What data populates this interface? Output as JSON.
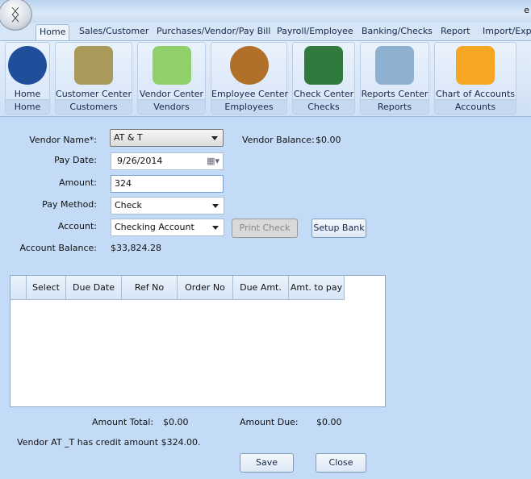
{
  "title_bar": {
    "right_text": "e"
  },
  "tabs": [
    "Home",
    "Sales/Customer",
    "Purchases/Vendor/Pay Bill",
    "Payroll/Employee",
    "Banking/Checks",
    "Report",
    "Import/Expo"
  ],
  "ribbon": [
    {
      "label": "Home",
      "group": "Home",
      "icon": "home-icon",
      "color": "#1f4f9a"
    },
    {
      "label": "Customer Center",
      "group": "Customers",
      "icon": "customer-folder-icon",
      "color": "#a99a5a"
    },
    {
      "label": "Vendor Center",
      "group": "Vendors",
      "icon": "vendor-book-icon",
      "color": "#8fd06a"
    },
    {
      "label": "Employee Center",
      "group": "Employees",
      "icon": "employee-group-icon",
      "color": "#b0702a"
    },
    {
      "label": "Check Center",
      "group": "Checks",
      "icon": "checkbook-icon",
      "color": "#2f7a3c"
    },
    {
      "label": "Reports Center",
      "group": "Reports",
      "icon": "reports-binder-icon",
      "color": "#8fb1d1"
    },
    {
      "label": "Chart of Accounts",
      "group": "Accounts",
      "icon": "accounts-folder-icon",
      "color": "#f5a623"
    }
  ],
  "form": {
    "vendor_name_label": "Vendor Name*:",
    "vendor_name": "AT & T",
    "vendor_balance_label": "Vendor Balance:",
    "vendor_balance": "$0.00",
    "pay_date_label": "Pay Date:",
    "pay_date": "9/26/2014",
    "amount_label": "Amount:",
    "amount": "324",
    "pay_method_label": "Pay Method:",
    "pay_method": "Check",
    "account_label": "Account:",
    "account": "Checking Account",
    "print_check": "Print Check",
    "setup_bank": "Setup Bank",
    "account_balance_label": "Account Balance:",
    "account_balance": "$33,824.28"
  },
  "grid": {
    "columns": [
      "Select",
      "Due Date",
      "Ref No",
      "Order No",
      "Due Amt.",
      "Amt. to pay"
    ]
  },
  "totals": {
    "amount_total_label": "Amount Total:",
    "amount_total": "$0.00",
    "amount_due_label": "Amount Due:",
    "amount_due": "$0.00"
  },
  "message": "Vendor AT _T has credit amount $324.00.",
  "buttons": {
    "save": "Save",
    "close": "Close"
  }
}
